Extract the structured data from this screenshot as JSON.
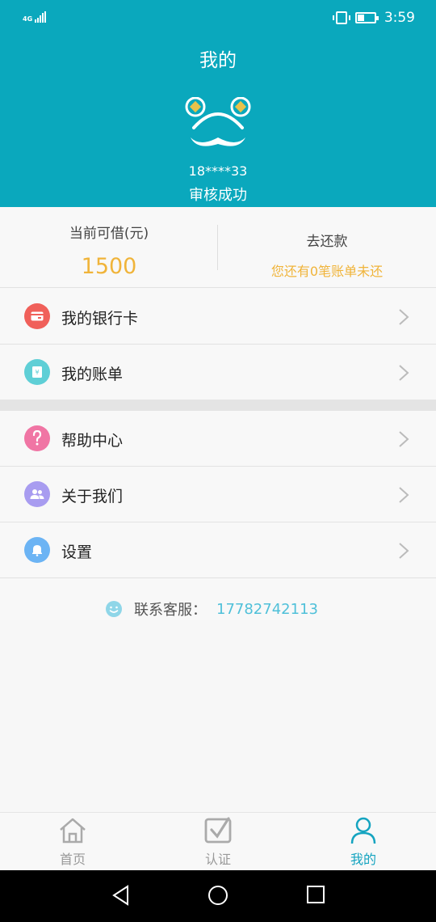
{
  "status_bar": {
    "network": "4G",
    "time": "3:59",
    "battery_percent": 40
  },
  "header": {
    "title": "我的",
    "username": "18****33",
    "status": "审核成功"
  },
  "summary": {
    "available_label": "当前可借(元)",
    "available_amount": "1500",
    "repay_label": "去还款",
    "bills_note": "您还有0笔账单未还"
  },
  "menu_group1": [
    {
      "label": "我的银行卡",
      "icon": "bank-card-icon",
      "color": "#f0605a"
    },
    {
      "label": "我的账单",
      "icon": "bill-icon",
      "color": "#5fcfd6"
    }
  ],
  "menu_group2": [
    {
      "label": "帮助中心",
      "icon": "help-icon",
      "color": "#f075a4"
    },
    {
      "label": "关于我们",
      "icon": "users-icon",
      "color": "#a89cf0"
    },
    {
      "label": "设置",
      "icon": "bell-icon",
      "color": "#6cb4f4"
    }
  ],
  "contact": {
    "label": "联系客服：",
    "phone": "17782742113"
  },
  "tabbar": {
    "tabs": [
      {
        "label": "首页",
        "icon": "home-icon"
      },
      {
        "label": "认证",
        "icon": "checkbox-icon"
      },
      {
        "label": "我的",
        "icon": "person-icon",
        "active": true
      }
    ]
  },
  "colors": {
    "primary": "#0aa8bd",
    "accent_amount": "#f0b43a",
    "link": "#4fc0d9"
  }
}
